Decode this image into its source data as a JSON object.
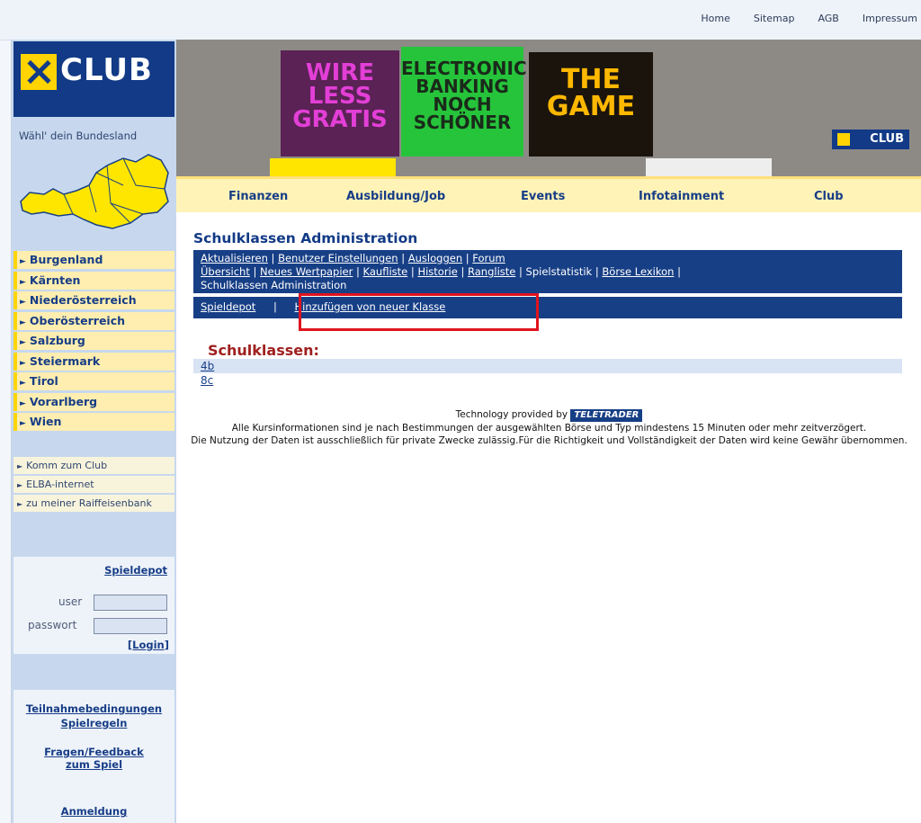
{
  "topnav": [
    "Home",
    "Sitemap",
    "AGB",
    "Impressum"
  ],
  "logo": {
    "text": "CLUB"
  },
  "sidebar": {
    "bundesland_label": "Wähl' dein Bundesland",
    "states": [
      "Burgenland",
      "Kärnten",
      "Niederösterreich",
      "Oberösterreich",
      "Salzburg",
      "Steiermark",
      "Tirol",
      "Vorarlberg",
      "Wien"
    ],
    "sublinks": [
      "Komm zum Club",
      "ELBA-internet",
      "zu meiner Raiffeisenbank"
    ],
    "login": {
      "heading": "Spieldepot",
      "user_label": "user",
      "password_label": "passwort",
      "login_link": "[Login]"
    },
    "footer_links": [
      "Teilnahmebedingungen",
      "Spielregeln",
      "Fragen/Feedback zum Spiel",
      "Anmeldung"
    ]
  },
  "banner": {
    "poster1": "WIRE LESS GRATIS",
    "poster2": "ELECTRONIC BANKING NOCH SCHÖNER",
    "poster3": "THE GAME",
    "club_badge": "CLUB"
  },
  "mainnav": [
    "Finanzen",
    "Ausbildung/Job",
    "Events",
    "Infotainment",
    "Club"
  ],
  "content": {
    "title": "Schulklassen Administration",
    "menu": [
      "Aktualisieren",
      "Benutzer Einstellungen",
      "Ausloggen",
      "Forum",
      "Übersicht",
      "Neues Wertpapier",
      "Kaufliste",
      "Historie",
      "Rangliste",
      "Spielstatistik",
      "Börse Lexikon",
      "Schulklassen Administration"
    ],
    "submenu": [
      "Spieldepot",
      "Hinzufügen von neuer Klasse"
    ],
    "schulklassen_heading": "Schulklassen:",
    "classes": [
      "4b",
      "8c"
    ],
    "tech_line": "Technology provided by",
    "teletrader": "TELETRADER",
    "disclaimer1": "Alle Kursinformationen sind je nach Bestimmungen der ausgewählten Börse und Typ mindestens 15 Minuten oder mehr zeitverzögert.",
    "disclaimer2": "Die Nutzung der Daten ist ausschließlich für private Zwecke zulässig.Für die Richtigkeit und Vollständigkeit der Daten wird keine Gewähr übernommen."
  },
  "colors": {
    "brand_blue": "#173f86",
    "brand_yellow": "#ffd400",
    "highlight_red": "#e0141e"
  }
}
